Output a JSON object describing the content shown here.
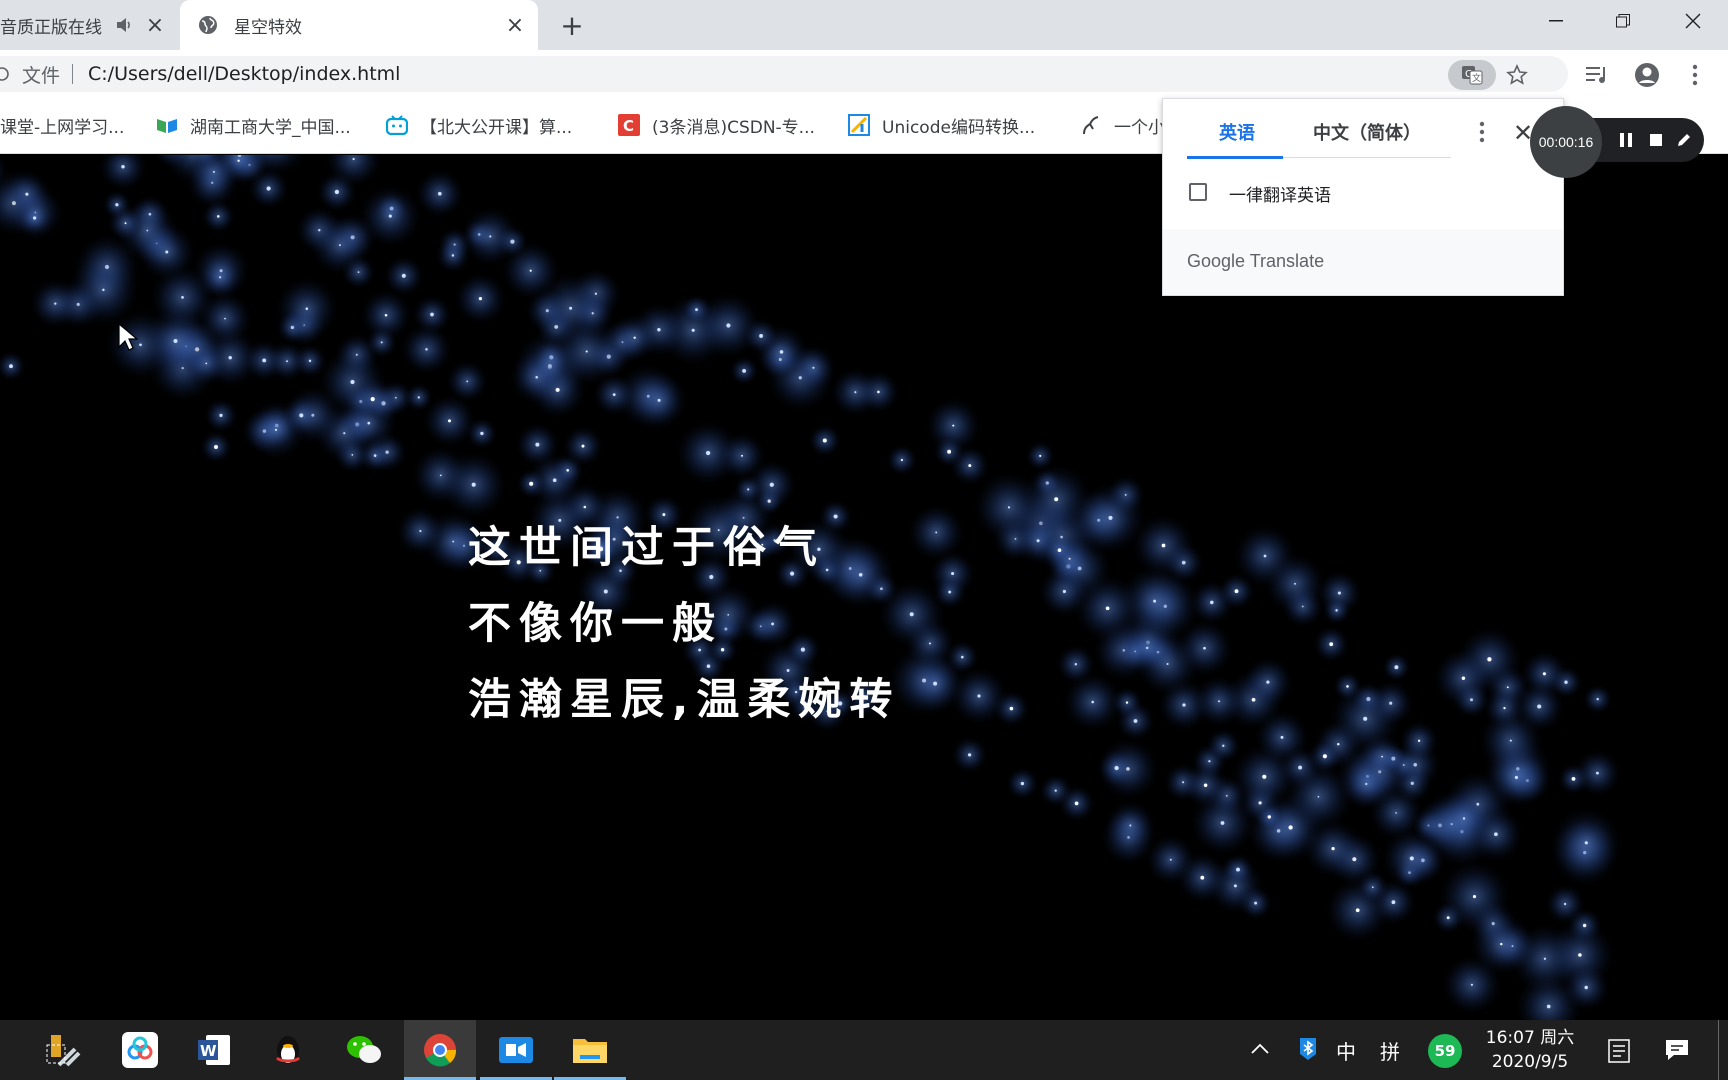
{
  "browser": {
    "tabs": [
      {
        "title": "音质正版在线",
        "audio": true,
        "active": false
      },
      {
        "title": "星空特效",
        "active": true
      }
    ],
    "address": {
      "scheme_label": "文件",
      "url": "C:/Users/dell/Desktop/index.html"
    },
    "bookmarks": [
      {
        "label": "课堂-上网学习..."
      },
      {
        "label": "湖南工商大学_中国..."
      },
      {
        "label": "【北大公开课】算..."
      },
      {
        "label": "(3条消息)CSDN-专..."
      },
      {
        "label": "Unicode编码转换..."
      },
      {
        "label": "一个小"
      }
    ]
  },
  "page": {
    "poem": [
      "这世间过于俗气",
      "不像你一般",
      "浩瀚星辰,温柔婉转"
    ]
  },
  "translate_popup": {
    "tab_source": "英语",
    "tab_target": "中文（简体）",
    "checkbox_label": "一律翻译英语",
    "brand": "Google Translate"
  },
  "recorder": {
    "timer": "00:00:16"
  },
  "taskbar": {
    "ime_lang": "中",
    "ime_mode": "拼",
    "badge_count": "59",
    "time": "16:07 周六",
    "date": "2020/9/5"
  },
  "colors": {
    "accent": "#1a73e8",
    "star_glow": "#3b5fa8"
  }
}
